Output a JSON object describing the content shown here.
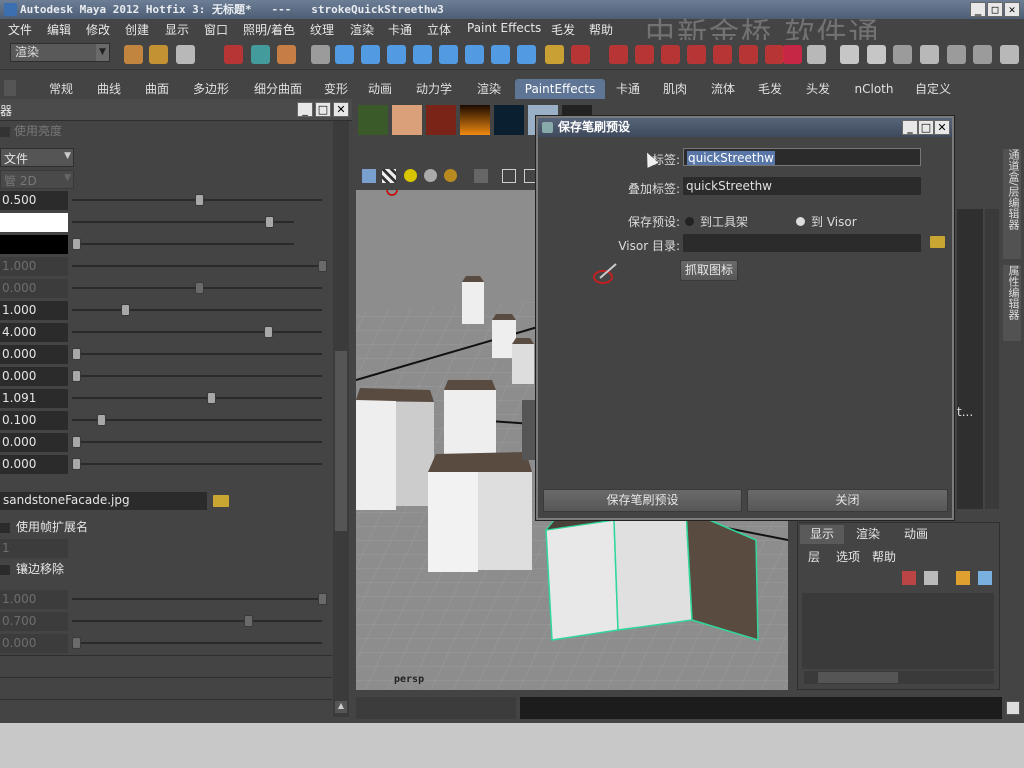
{
  "title_bar": {
    "text": "Autodesk Maya 2012 Hotfix 3: 无标题*   ---   strokeQuickStreethw3"
  },
  "watermark": "中新金桥 软件通",
  "menubar": [
    "文件",
    "编辑",
    "修改",
    "创建",
    "显示",
    "窗口",
    "照明/着色",
    "纹理",
    "渲染",
    "卡通",
    "立体",
    "Paint Effects",
    "毛发",
    "帮助"
  ],
  "toolbar": {
    "mode_value": "渲染"
  },
  "shelf_tabs": [
    "常规",
    "曲线",
    "曲面",
    "多边形",
    "细分曲面",
    "变形",
    "动画",
    "动力学",
    "渲染",
    "PaintEffects",
    "卡通",
    "肌肉",
    "流体",
    "毛发",
    "头发",
    "nCloth",
    "自定义"
  ],
  "shelf_active": "PaintEffects",
  "left_panel": {
    "title": "器",
    "top_check": "使用亮度",
    "file_dropdown": "文件",
    "dim_dropdown": "管 2D",
    "rows": [
      {
        "value": "0.500",
        "pos": 0.5,
        "dim": false
      },
      {
        "value": "",
        "pos": 0.87,
        "dim": false,
        "swatch": "#ffffff"
      },
      {
        "value": "",
        "pos": 0.0,
        "dim": false,
        "swatch": "#000000"
      },
      {
        "value": "1.000",
        "pos": 1.0,
        "dim": true
      },
      {
        "value": "0.000",
        "pos": 0.5,
        "dim": true
      },
      {
        "value": "1.000",
        "pos": 0.2,
        "dim": false
      },
      {
        "value": "4.000",
        "pos": 0.78,
        "dim": false
      },
      {
        "value": "0.000",
        "pos": 0.0,
        "dim": false
      },
      {
        "value": "0.000",
        "pos": 0.0,
        "dim": false
      },
      {
        "value": "1.091",
        "pos": 0.55,
        "dim": false
      },
      {
        "value": "0.100",
        "pos": 0.1,
        "dim": false
      },
      {
        "value": "0.000",
        "pos": 0.0,
        "dim": false
      },
      {
        "value": "0.000",
        "pos": 0.0,
        "dim": false
      }
    ],
    "file_name": "sandstoneFacade.jpg",
    "check_frame_ext": "使用帧扩展名",
    "frame_value": "1",
    "check_edge": "镶边移除",
    "bottom_rows": [
      {
        "value": "1.000",
        "pos": 1.0
      },
      {
        "value": "0.700",
        "pos": 0.7
      },
      {
        "value": "0.000",
        "pos": 0.0
      }
    ]
  },
  "viewport": {
    "camera_label": "persp"
  },
  "dialog": {
    "title": "保存笔刷预设",
    "label_label": "标签:",
    "label_value": "quickStreethw",
    "overlay_label": "叠加标签:",
    "overlay_value": "quickStreethw",
    "save_preset_label": "保存预设:",
    "radio_shelf": "到工具架",
    "radio_visor": "到 Visor",
    "radio_selected": "到 Visor",
    "visor_dir_label": "Visor 目录:",
    "visor_dir_value": "",
    "grab_icon_button": "抓取图标",
    "save_button": "保存笔刷预设",
    "close_button": "关闭"
  },
  "layer_panel": {
    "tabs": [
      "显示",
      "渲染",
      "动画"
    ],
    "active_tab": "显示",
    "menu": [
      "层",
      "选项",
      "帮助"
    ]
  },
  "right_side": {
    "vertical_tab_1": "通道盒/层编辑器",
    "vertical_tab_2": "属性编辑器",
    "partial_text": "t..."
  }
}
